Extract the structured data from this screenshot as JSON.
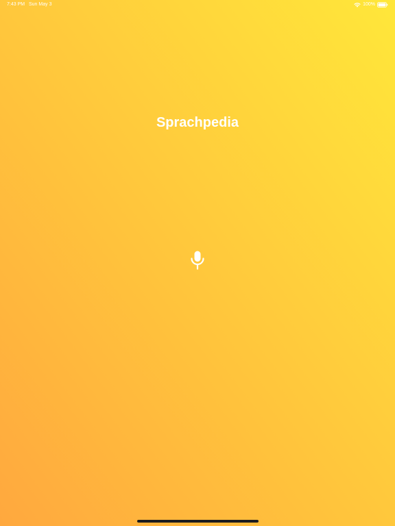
{
  "status_bar": {
    "time": "7:43 PM",
    "date": "Sun May 3",
    "battery": "100%",
    "wifi_icon": "wifi-icon",
    "battery_icon": "battery-icon"
  },
  "app": {
    "title": "Sprachpedia",
    "mic_icon": "microphone-icon"
  },
  "colors": {
    "gradient_top_right": "#FFE73A",
    "gradient_bottom_left": "#FFA83E",
    "text": "#FFFFFF",
    "home_indicator": "#1C1C1E"
  }
}
